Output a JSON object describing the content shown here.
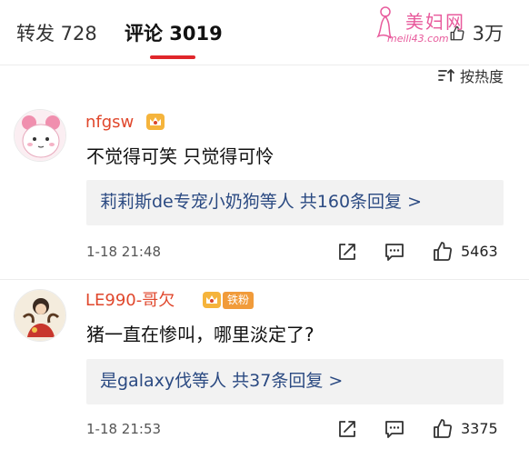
{
  "tabs": {
    "repost_label": "转发 728",
    "comments_label": "评论 3019",
    "likes_label": "3万"
  },
  "watermark": {
    "title": "美妇网",
    "url": "meili43.com"
  },
  "sort": {
    "label": "按热度"
  },
  "comments": [
    {
      "username": "nfgsw",
      "text": "不觉得可笑 只觉得可怜",
      "replies_text": "莉莉斯de专宠小奶狗等人  共160条回复 >",
      "time": "1-18 21:48",
      "likes": "5463"
    },
    {
      "username": "LE990-哥欠",
      "badge": "铁粉",
      "text": "猪一直在惨叫，哪里淡定了?",
      "replies_text": "是galaxy伐等人  共37条回复 >",
      "time": "1-18 21:53",
      "likes": "3375"
    }
  ],
  "colors": {
    "accent_red": "#e0262b",
    "username": "#e0472c",
    "reply_link": "#2b4a82",
    "reply_bg": "#f2f2f2"
  },
  "icons": [
    "crown-icon",
    "sort-icon",
    "share-icon",
    "comment-icon",
    "like-icon"
  ]
}
